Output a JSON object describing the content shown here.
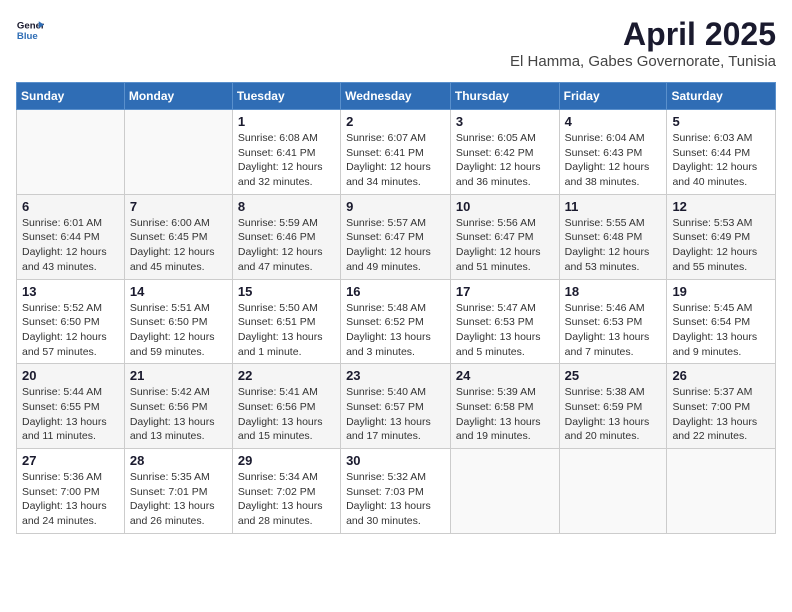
{
  "header": {
    "logo_line1": "General",
    "logo_line2": "Blue",
    "title": "April 2025",
    "subtitle": "El Hamma, Gabes Governorate, Tunisia"
  },
  "calendar": {
    "columns": [
      "Sunday",
      "Monday",
      "Tuesday",
      "Wednesday",
      "Thursday",
      "Friday",
      "Saturday"
    ],
    "weeks": [
      [
        {
          "day": "",
          "info": ""
        },
        {
          "day": "",
          "info": ""
        },
        {
          "day": "1",
          "info": "Sunrise: 6:08 AM\nSunset: 6:41 PM\nDaylight: 12 hours\nand 32 minutes."
        },
        {
          "day": "2",
          "info": "Sunrise: 6:07 AM\nSunset: 6:41 PM\nDaylight: 12 hours\nand 34 minutes."
        },
        {
          "day": "3",
          "info": "Sunrise: 6:05 AM\nSunset: 6:42 PM\nDaylight: 12 hours\nand 36 minutes."
        },
        {
          "day": "4",
          "info": "Sunrise: 6:04 AM\nSunset: 6:43 PM\nDaylight: 12 hours\nand 38 minutes."
        },
        {
          "day": "5",
          "info": "Sunrise: 6:03 AM\nSunset: 6:44 PM\nDaylight: 12 hours\nand 40 minutes."
        }
      ],
      [
        {
          "day": "6",
          "info": "Sunrise: 6:01 AM\nSunset: 6:44 PM\nDaylight: 12 hours\nand 43 minutes."
        },
        {
          "day": "7",
          "info": "Sunrise: 6:00 AM\nSunset: 6:45 PM\nDaylight: 12 hours\nand 45 minutes."
        },
        {
          "day": "8",
          "info": "Sunrise: 5:59 AM\nSunset: 6:46 PM\nDaylight: 12 hours\nand 47 minutes."
        },
        {
          "day": "9",
          "info": "Sunrise: 5:57 AM\nSunset: 6:47 PM\nDaylight: 12 hours\nand 49 minutes."
        },
        {
          "day": "10",
          "info": "Sunrise: 5:56 AM\nSunset: 6:47 PM\nDaylight: 12 hours\nand 51 minutes."
        },
        {
          "day": "11",
          "info": "Sunrise: 5:55 AM\nSunset: 6:48 PM\nDaylight: 12 hours\nand 53 minutes."
        },
        {
          "day": "12",
          "info": "Sunrise: 5:53 AM\nSunset: 6:49 PM\nDaylight: 12 hours\nand 55 minutes."
        }
      ],
      [
        {
          "day": "13",
          "info": "Sunrise: 5:52 AM\nSunset: 6:50 PM\nDaylight: 12 hours\nand 57 minutes."
        },
        {
          "day": "14",
          "info": "Sunrise: 5:51 AM\nSunset: 6:50 PM\nDaylight: 12 hours\nand 59 minutes."
        },
        {
          "day": "15",
          "info": "Sunrise: 5:50 AM\nSunset: 6:51 PM\nDaylight: 13 hours\nand 1 minute."
        },
        {
          "day": "16",
          "info": "Sunrise: 5:48 AM\nSunset: 6:52 PM\nDaylight: 13 hours\nand 3 minutes."
        },
        {
          "day": "17",
          "info": "Sunrise: 5:47 AM\nSunset: 6:53 PM\nDaylight: 13 hours\nand 5 minutes."
        },
        {
          "day": "18",
          "info": "Sunrise: 5:46 AM\nSunset: 6:53 PM\nDaylight: 13 hours\nand 7 minutes."
        },
        {
          "day": "19",
          "info": "Sunrise: 5:45 AM\nSunset: 6:54 PM\nDaylight: 13 hours\nand 9 minutes."
        }
      ],
      [
        {
          "day": "20",
          "info": "Sunrise: 5:44 AM\nSunset: 6:55 PM\nDaylight: 13 hours\nand 11 minutes."
        },
        {
          "day": "21",
          "info": "Sunrise: 5:42 AM\nSunset: 6:56 PM\nDaylight: 13 hours\nand 13 minutes."
        },
        {
          "day": "22",
          "info": "Sunrise: 5:41 AM\nSunset: 6:56 PM\nDaylight: 13 hours\nand 15 minutes."
        },
        {
          "day": "23",
          "info": "Sunrise: 5:40 AM\nSunset: 6:57 PM\nDaylight: 13 hours\nand 17 minutes."
        },
        {
          "day": "24",
          "info": "Sunrise: 5:39 AM\nSunset: 6:58 PM\nDaylight: 13 hours\nand 19 minutes."
        },
        {
          "day": "25",
          "info": "Sunrise: 5:38 AM\nSunset: 6:59 PM\nDaylight: 13 hours\nand 20 minutes."
        },
        {
          "day": "26",
          "info": "Sunrise: 5:37 AM\nSunset: 7:00 PM\nDaylight: 13 hours\nand 22 minutes."
        }
      ],
      [
        {
          "day": "27",
          "info": "Sunrise: 5:36 AM\nSunset: 7:00 PM\nDaylight: 13 hours\nand 24 minutes."
        },
        {
          "day": "28",
          "info": "Sunrise: 5:35 AM\nSunset: 7:01 PM\nDaylight: 13 hours\nand 26 minutes."
        },
        {
          "day": "29",
          "info": "Sunrise: 5:34 AM\nSunset: 7:02 PM\nDaylight: 13 hours\nand 28 minutes."
        },
        {
          "day": "30",
          "info": "Sunrise: 5:32 AM\nSunset: 7:03 PM\nDaylight: 13 hours\nand 30 minutes."
        },
        {
          "day": "",
          "info": ""
        },
        {
          "day": "",
          "info": ""
        },
        {
          "day": "",
          "info": ""
        }
      ]
    ]
  }
}
